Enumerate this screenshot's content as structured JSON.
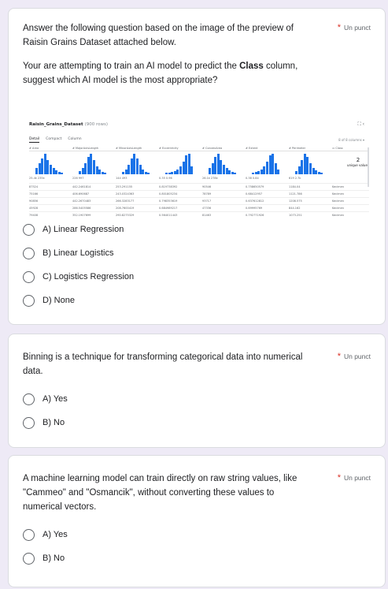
{
  "q1": {
    "text_intro": "Answer the following question based on the image of the preview of Raisin Grains Dataset attached below.",
    "text_part1": "Your are attempting to train an AI model to predict the ",
    "text_bold": "Class",
    "text_part2": " column, suggest which AI model is the most appropriate?",
    "points": "Un punct",
    "options": [
      "A) Linear Regression",
      "B) Linear Logistics",
      "C) Logistics Regression",
      "D) None"
    ]
  },
  "q2": {
    "text": "Binning is a technique for transforming categorical data into numerical data.",
    "points": "Un punct",
    "options": [
      "A) Yes",
      "B) No"
    ]
  },
  "q3": {
    "text": "A machine learning model can train directly on raw string values, like \"Cammeo\" and \"Osmancik\", without converting these values to numerical vectors.",
    "points": "Un punct",
    "options": [
      "A) Yes",
      "B) No"
    ]
  },
  "preview": {
    "title": "Raisin_Grains_Dataset",
    "row_count": "(900 rows)",
    "icons": "⛶ ‹",
    "tabs": [
      "Detail",
      "Compact",
      "Column"
    ],
    "column_count": "8 of 8 columns ▾",
    "headers": [
      "# Area",
      "# MajorAxisLength",
      "# MinorAxisLength",
      "# Eccentricity",
      "# ConvexArea",
      "# Extent",
      "# Perimeter",
      "▭ Class"
    ],
    "ranges": [
      "25.4k   235k",
      "226   997",
      "144   493",
      "0.35   0.96",
      "26.1k   278k",
      "0.38   0.84",
      "619   2.7k"
    ],
    "class_summary": {
      "count": "2",
      "label": "unique values"
    },
    "rows": [
      [
        "87524",
        "442.2461814",
        "253.291155",
        "0.819738392",
        "90546",
        "0.758650579",
        "1184.04",
        "Kecimen"
      ],
      [
        "75166",
        "406.690687",
        "243.0324363",
        "0.801805234",
        "78789",
        "0.68412957",
        "1121.786",
        "Kecimen"
      ],
      [
        "90856",
        "442.2670483",
        "266.3283177",
        "0.798353619",
        "93717",
        "0.637612812",
        "1208.575",
        "Kecimen"
      ],
      [
        "45928",
        "286.5405586",
        "208.7600419",
        "0.684989217",
        "47336",
        "0.69995769",
        "844.162",
        "Kecimen"
      ],
      [
        "79408",
        "352.1907699",
        "290.8275329",
        "0.564011443",
        "81463",
        "0.792771926",
        "1073.251",
        "Kecimen"
      ]
    ]
  }
}
